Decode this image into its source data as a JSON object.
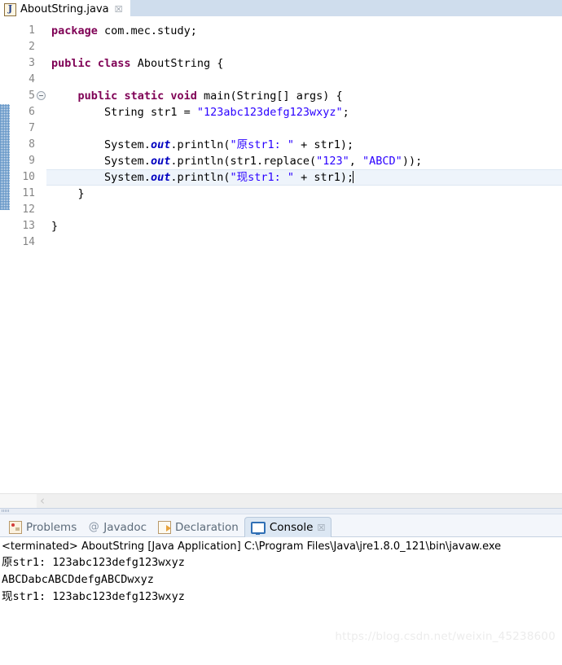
{
  "editor_tab": {
    "title": "AboutString.java",
    "icon": "java-file-icon",
    "close_glyph": "☒"
  },
  "editor": {
    "current_line": 10,
    "lines": [
      {
        "n": "1",
        "fold": false
      },
      {
        "n": "2",
        "fold": false
      },
      {
        "n": "3",
        "fold": false
      },
      {
        "n": "4",
        "fold": false
      },
      {
        "n": "5",
        "fold": true
      },
      {
        "n": "6",
        "fold": false
      },
      {
        "n": "7",
        "fold": false
      },
      {
        "n": "8",
        "fold": false
      },
      {
        "n": "9",
        "fold": false
      },
      {
        "n": "10",
        "fold": false
      },
      {
        "n": "11",
        "fold": false
      },
      {
        "n": "12",
        "fold": false
      },
      {
        "n": "13",
        "fold": false
      },
      {
        "n": "14",
        "fold": false
      }
    ],
    "code": {
      "l1_kw": "package",
      "l1_rest": " com.mec.study;",
      "l3_kw1": "public",
      "l3_kw2": "class",
      "l3_rest": " AboutString {",
      "l5_kw1": "public",
      "l5_kw2": "static",
      "l5_kw3": "void",
      "l5_rest": " main(String[] args) {",
      "l6_kw": "String",
      "l6_mid": " str1 = ",
      "l6_str": "\"123abc123defg123wxyz\"",
      "l6_end": ";",
      "l8_pre": "System.",
      "l8_fld": "out",
      "l8_mid": ".println(",
      "l8_str": "\"原str1: \"",
      "l8_end": " + str1);",
      "l9_pre": "System.",
      "l9_fld": "out",
      "l9_mid": ".println(str1.replace(",
      "l9_str1": "\"123\"",
      "l9_sep": ", ",
      "l9_str2": "\"ABCD\"",
      "l9_end": "));",
      "l10_pre": "System.",
      "l10_fld": "out",
      "l10_mid": ".println(",
      "l10_str": "\"现str1: \"",
      "l10_end": " + str1);",
      "l11": "    }",
      "l13": "}"
    },
    "scroll_left_glyph": "‹"
  },
  "view_tabs": [
    {
      "label": "Problems",
      "icon": "problems-icon",
      "active": false
    },
    {
      "label": "Javadoc",
      "icon": "javadoc-icon",
      "active": false
    },
    {
      "label": "Declaration",
      "icon": "declaration-icon",
      "active": false
    },
    {
      "label": "Console",
      "icon": "console-icon",
      "active": true
    }
  ],
  "console": {
    "close_glyph": "☒",
    "header": "<terminated> AboutString [Java Application] C:\\Program Files\\Java\\jre1.8.0_121\\bin\\javaw.exe",
    "output": [
      "原str1: 123abc123defg123wxyz",
      "ABCDabcABCDdefgABCDwxyz",
      "现str1: 123abc123defg123wxyz"
    ]
  },
  "watermark": "https://blog.csdn.net/weixin_45238600",
  "colors": {
    "keyword": "#7F0055",
    "string": "#2A00FF",
    "static_field": "#0000C0",
    "line_number": "#868686",
    "current_line_bg": "#EEF4FB",
    "tab_band": "#CFDDED"
  }
}
